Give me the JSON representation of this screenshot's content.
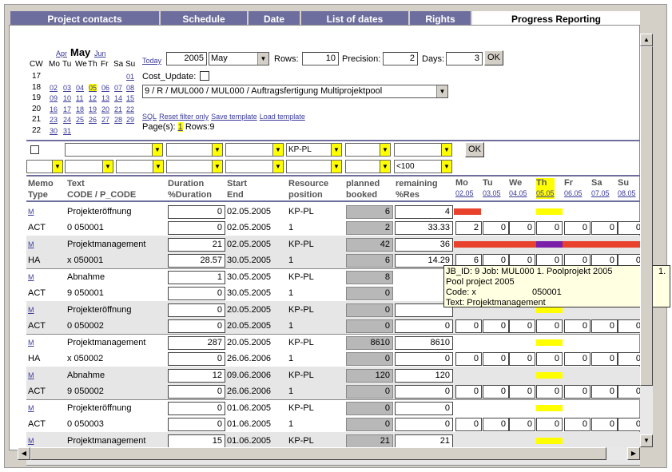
{
  "tabs": [
    "Project contacts",
    "Schedule",
    "Date",
    "List of dates",
    "Rights",
    "Progress Reporting"
  ],
  "calendar": {
    "prev_month": "Apr",
    "month": "May",
    "next_month": "Jun",
    "headers": [
      "CW",
      "Mo",
      "Tu",
      "We",
      "Th",
      "Fr",
      "Sa",
      "Su"
    ],
    "weeks": [
      {
        "cw": "17",
        "days": [
          "",
          "",
          "",
          "",
          "",
          "",
          "01"
        ]
      },
      {
        "cw": "18",
        "days": [
          "02",
          "03",
          "04",
          "05",
          "06",
          "07",
          "08"
        ]
      },
      {
        "cw": "19",
        "days": [
          "09",
          "10",
          "11",
          "12",
          "13",
          "14",
          "15"
        ]
      },
      {
        "cw": "20",
        "days": [
          "16",
          "17",
          "18",
          "19",
          "20",
          "21",
          "22"
        ]
      },
      {
        "cw": "21",
        "days": [
          "23",
          "24",
          "25",
          "26",
          "27",
          "28",
          "29"
        ]
      },
      {
        "cw": "22",
        "days": [
          "30",
          "31",
          "",
          "",
          "",
          "",
          ""
        ]
      }
    ],
    "today_day": "05"
  },
  "controls": {
    "today_link": "Today",
    "year": "2005",
    "month_select": "May",
    "rows_label": "Rows:",
    "rows": "10",
    "precision_label": "Precision:",
    "precision": "2",
    "days_label": "Days:",
    "days": "3",
    "ok": "OK",
    "cost_update_label": "Cost_Update:",
    "project_select": "9 / R / MUL000 / MUL000 / Auftragsfertigung Multiprojektpool",
    "links": [
      "SQL",
      "Reset filter only",
      "Save template",
      "Load template"
    ],
    "pages_label": "Page(s):",
    "page_num": "1",
    "rows_info": "Rows:9"
  },
  "filters": {
    "resource": "KP-PL",
    "remaining": "<100",
    "ok": "OK"
  },
  "columns": {
    "memo": [
      "Memo",
      "Type"
    ],
    "text": [
      "Text",
      "CODE / P_CODE"
    ],
    "duration": [
      "Duration",
      "%Duration"
    ],
    "start": [
      "Start",
      "End"
    ],
    "resource": [
      "Resource",
      "position"
    ],
    "planned": [
      "planned",
      "booked"
    ],
    "remaining": [
      "remaining",
      "%Res"
    ],
    "days": [
      [
        "Mo",
        "02.05"
      ],
      [
        "Tu",
        "03.05"
      ],
      [
        "We",
        "04.05"
      ],
      [
        "Th",
        "05.05"
      ],
      [
        "Fr",
        "06.05"
      ],
      [
        "Sa",
        "07.05"
      ],
      [
        "Su",
        "08.05"
      ]
    ]
  },
  "rows": [
    {
      "memo": "M",
      "type": "ACT",
      "text": "Projekteröffnung",
      "code": "0 050001",
      "dur": "0",
      "pdur": "0",
      "start": "02.05.2005",
      "end": "02.05.2005",
      "res": "KP-PL",
      "pos": "1",
      "planned": "6",
      "booked": "2",
      "remaining": "4",
      "pres": "33.33",
      "days": [
        "2",
        "0",
        "0",
        "0",
        "0",
        "0",
        "0"
      ]
    },
    {
      "memo": "M",
      "type": "HA",
      "text": "Projektmanagement",
      "code": "x 050001",
      "dur": "21",
      "pdur": "28.57",
      "start": "02.05.2005",
      "end": "30.05.2005",
      "res": "KP-PL",
      "pos": "1",
      "planned": "42",
      "booked": "6",
      "remaining": "36",
      "pres": "14.29",
      "days": [
        "6",
        "0",
        "0",
        "0",
        "0",
        "0",
        "0"
      ]
    },
    {
      "memo": "M",
      "type": "ACT",
      "text": "Abnahme",
      "code": "9 050001",
      "dur": "1",
      "pdur": "0",
      "start": "30.05.2005",
      "end": "30.05.2005",
      "res": "KP-PL",
      "pos": "1",
      "planned": "8",
      "booked": "0",
      "remaining": "",
      "pres": "",
      "days": []
    },
    {
      "memo": "M",
      "type": "ACT",
      "text": "Projekteröffnung",
      "code": "0 050002",
      "dur": "0",
      "pdur": "0",
      "start": "20.05.2005",
      "end": "20.05.2005",
      "res": "KP-PL",
      "pos": "1",
      "planned": "0",
      "booked": "0",
      "remaining": "",
      "pres": "0",
      "days": [
        "0",
        "0",
        "0",
        "0",
        "0",
        "0",
        "0"
      ]
    },
    {
      "memo": "M",
      "type": "HA",
      "text": "Projektmanagement",
      "code": "x 050002",
      "dur": "287",
      "pdur": "0",
      "start": "20.05.2005",
      "end": "26.06.2006",
      "res": "KP-PL",
      "pos": "1",
      "planned": "8610",
      "booked": "0",
      "remaining": "8610",
      "pres": "0",
      "days": [
        "0",
        "0",
        "0",
        "0",
        "0",
        "0",
        "0"
      ]
    },
    {
      "memo": "M",
      "type": "ACT",
      "text": "Abnahme",
      "code": "9 050002",
      "dur": "12",
      "pdur": "0",
      "start": "09.06.2006",
      "end": "26.06.2006",
      "res": "KP-PL",
      "pos": "1",
      "planned": "120",
      "booked": "0",
      "remaining": "120",
      "pres": "0",
      "days": [
        "0",
        "0",
        "0",
        "0",
        "0",
        "0",
        "0"
      ]
    },
    {
      "memo": "M",
      "type": "ACT",
      "text": "Projekteröffnung",
      "code": "0 050003",
      "dur": "0",
      "pdur": "0",
      "start": "01.06.2005",
      "end": "01.06.2005",
      "res": "KP-PL",
      "pos": "1",
      "planned": "0",
      "booked": "0",
      "remaining": "0",
      "pres": "0",
      "days": [
        "0",
        "0",
        "0",
        "0",
        "0",
        "0",
        "0"
      ]
    },
    {
      "memo": "M",
      "type": "",
      "text": "Projektmanagement",
      "code": "",
      "dur": "15",
      "pdur": "",
      "start": "01.06.2005",
      "end": "",
      "res": "KP-PL",
      "pos": "",
      "planned": "21",
      "booked": "",
      "remaining": "21",
      "pres": "",
      "days": []
    }
  ],
  "tooltip": [
    "JB_ID: 9 Job: MUL000 1. Poolprojekt 2005",
    "1.",
    "Pool project 2005",
    "Code: x",
    "050001",
    "Text: Projektmanagement"
  ],
  "colors": {
    "tab": "#6e6e9e",
    "bar_red": "#e8412c",
    "bar_yellow": "#ffff00",
    "bar_purple": "#7a1fa8"
  }
}
